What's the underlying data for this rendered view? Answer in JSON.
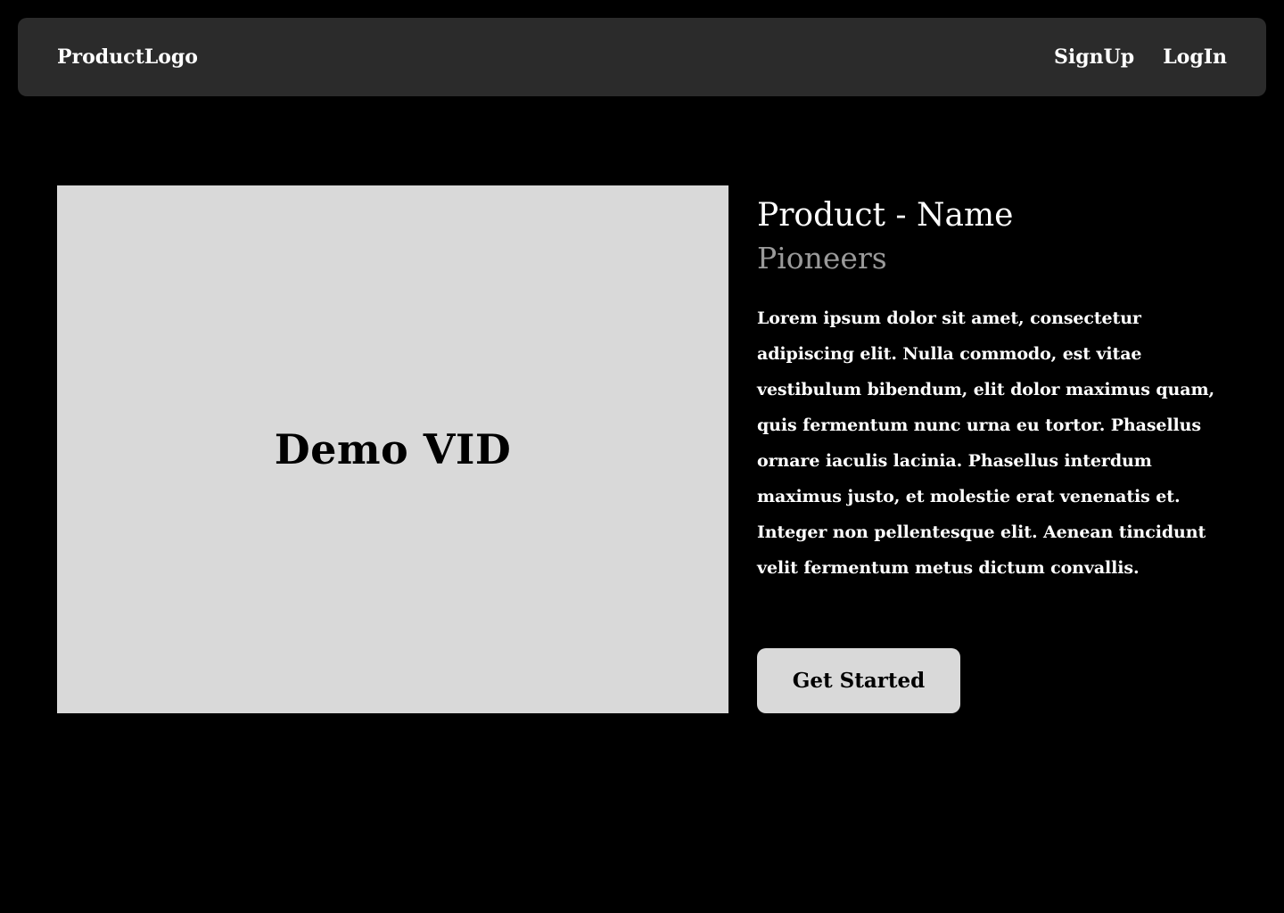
{
  "nav": {
    "logo": "ProductLogo",
    "links": [
      {
        "label": "SignUp"
      },
      {
        "label": "LogIn"
      }
    ]
  },
  "hero": {
    "video_label": "Demo VID",
    "product_name": "Product - Name",
    "tagline": "Pioneers",
    "description": "Lorem ipsum dolor sit amet, consectetur adipiscing elit. Nulla commodo, est vitae vestibulum bibendum, elit dolor maximus quam, quis fermentum nunc urna eu tortor. Phasellus ornare iaculis lacinia. Phasellus interdum maximus justo, et molestie erat venenatis et. Integer non pellentesque elit. Aenean tincidunt velit fermentum metus dictum convallis.",
    "cta_label": "Get Started"
  },
  "colors": {
    "background": "#000000",
    "navbar": "#2b2b2b",
    "placeholder": "#d9d9d9",
    "text_primary": "#ffffff",
    "text_muted": "#9a9a9a"
  }
}
